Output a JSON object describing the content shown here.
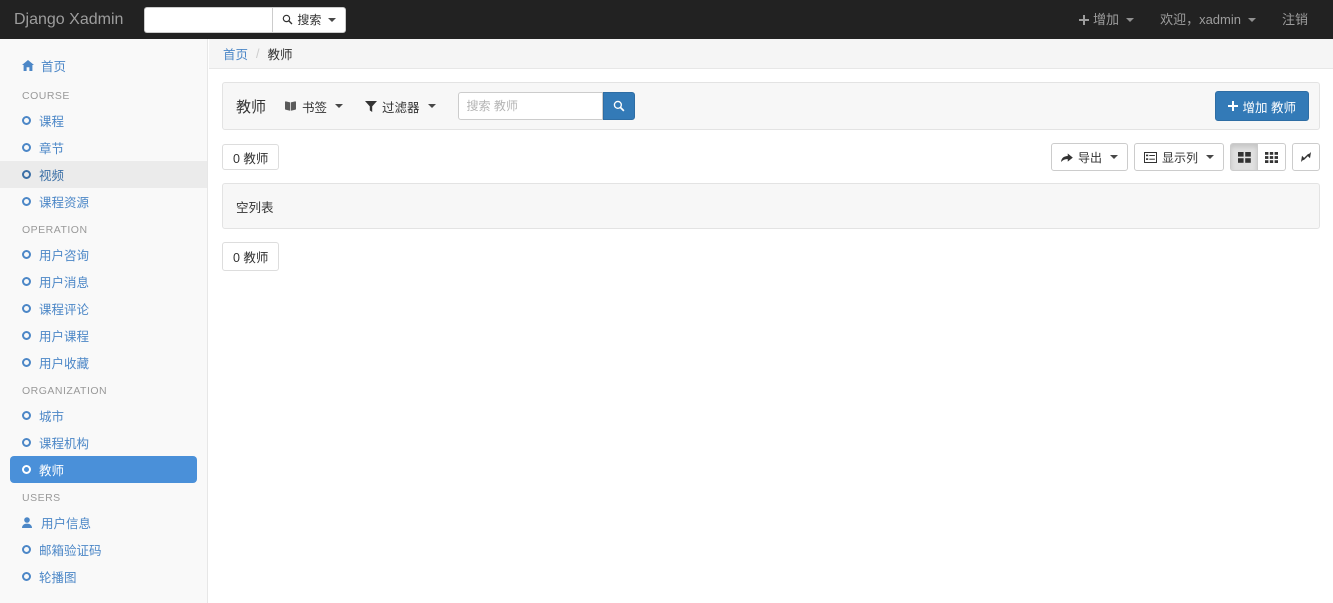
{
  "navbar": {
    "brand": "Django Xadmin",
    "search_value": "",
    "search_placeholder": "",
    "search_button_label": "搜索",
    "add_label": "增加",
    "welcome_label": "欢迎，xadmin",
    "logout_label": "注销"
  },
  "sidebar": {
    "home": {
      "label": "首页",
      "icon": "home-icon"
    },
    "groups": [
      {
        "header": "COURSE",
        "items": [
          {
            "label": "课程",
            "icon": "circle-icon",
            "state": "normal"
          },
          {
            "label": "章节",
            "icon": "circle-icon",
            "state": "normal"
          },
          {
            "label": "视频",
            "icon": "circle-icon",
            "state": "hovered"
          },
          {
            "label": "课程资源",
            "icon": "circle-icon",
            "state": "normal"
          }
        ]
      },
      {
        "header": "OPERATION",
        "items": [
          {
            "label": "用户咨询",
            "icon": "circle-icon",
            "state": "normal"
          },
          {
            "label": "用户消息",
            "icon": "circle-icon",
            "state": "normal"
          },
          {
            "label": "课程评论",
            "icon": "circle-icon",
            "state": "normal"
          },
          {
            "label": "用户课程",
            "icon": "circle-icon",
            "state": "normal"
          },
          {
            "label": "用户收藏",
            "icon": "circle-icon",
            "state": "normal"
          }
        ]
      },
      {
        "header": "ORGANIZATION",
        "items": [
          {
            "label": "城市",
            "icon": "circle-icon",
            "state": "normal"
          },
          {
            "label": "课程机构",
            "icon": "circle-icon",
            "state": "normal"
          },
          {
            "label": "教师",
            "icon": "circle-icon",
            "state": "active"
          }
        ]
      },
      {
        "header": "USERS",
        "items": [
          {
            "label": "用户信息",
            "icon": "user-icon",
            "state": "normal"
          },
          {
            "label": "邮箱验证码",
            "icon": "circle-icon",
            "state": "normal"
          },
          {
            "label": "轮播图",
            "icon": "circle-icon",
            "state": "normal"
          }
        ]
      }
    ]
  },
  "breadcrumb": {
    "home": "首页",
    "separator": "/",
    "current": "教师"
  },
  "toolbar": {
    "title": "教师",
    "bookmark_label": "书签",
    "filter_label": "过滤器",
    "search_value": "",
    "search_placeholder": "搜索 教师",
    "add_label": "增加 教师"
  },
  "list": {
    "count_badge_top": "0 教师",
    "empty_message": "空列表",
    "count_badge_bottom": "0 教师",
    "export_label": "导出",
    "columns_label": "显示列",
    "view_grid_large": "th-large-icon",
    "view_grid_small": "th-icon",
    "expand_label": "resize-full-icon"
  },
  "colors": {
    "navbar_bg": "#222222",
    "accent": "#337ab7",
    "sidebar_active": "#4a90d9",
    "link": "#4c87c7",
    "panel_bg": "#f7f7f7"
  }
}
